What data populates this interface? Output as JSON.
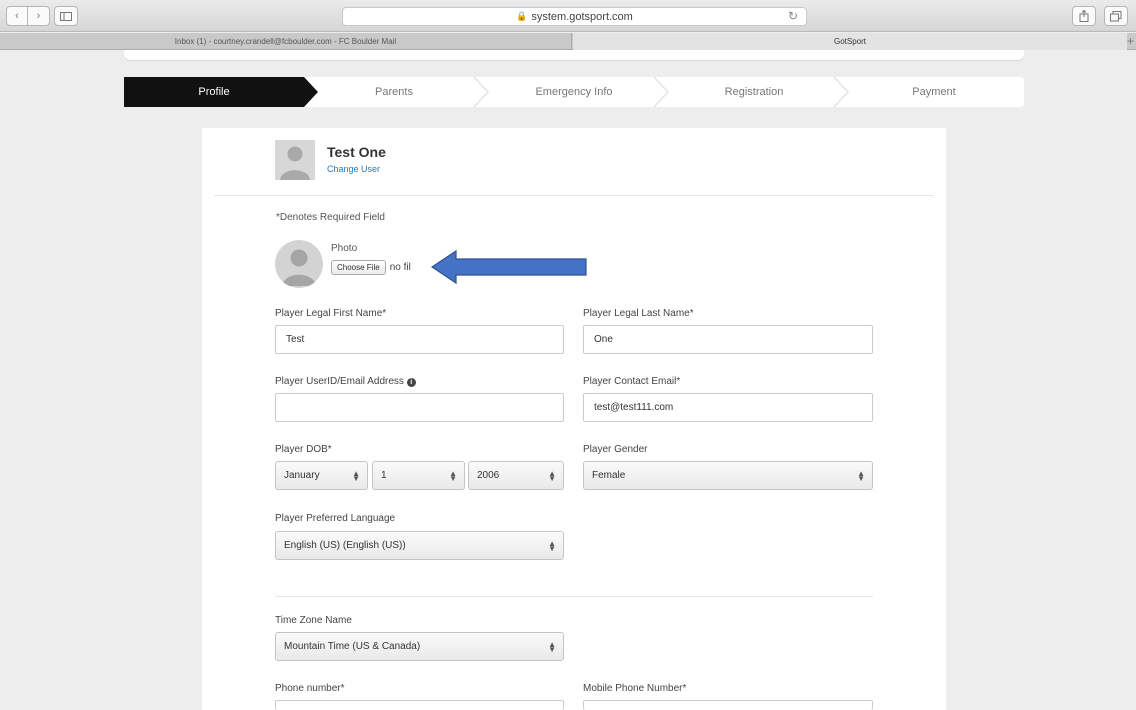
{
  "browser": {
    "url": "system.gotsport.com",
    "tabs": [
      {
        "label": "Inbox (1) - courtney.crandell@fcboulder.com - FC Boulder Mail"
      },
      {
        "label": "GotSport"
      }
    ]
  },
  "steps": [
    "Profile",
    "Parents",
    "Emergency Info",
    "Registration",
    "Payment"
  ],
  "user": {
    "name": "Test One",
    "change_label": "Change User"
  },
  "required_note": "*Denotes Required Field",
  "photo": {
    "label": "Photo",
    "button": "Choose File",
    "status": "no fil"
  },
  "fields": {
    "first_name": {
      "label": "Player Legal First Name*",
      "value": "Test"
    },
    "last_name": {
      "label": "Player Legal Last Name*",
      "value": "One"
    },
    "userid": {
      "label": "Player UserID/Email Address",
      "value": ""
    },
    "contact_email": {
      "label": "Player Contact Email*",
      "value": "test@test111.com"
    },
    "dob": {
      "label": "Player DOB*",
      "month": "January",
      "day": "1",
      "year": "2006"
    },
    "gender": {
      "label": "Player Gender",
      "value": "Female"
    },
    "language": {
      "label": "Player Preferred Language",
      "value": "English (US) (English (US))"
    },
    "timezone": {
      "label": "Time Zone Name",
      "value": "Mountain Time (US & Canada)"
    },
    "phone": {
      "label": "Phone number*"
    },
    "mobile": {
      "label": "Mobile Phone Number*"
    }
  },
  "colors": {
    "active_step": "#111111",
    "link": "#1f7ac2",
    "arrow": "#4472c4"
  }
}
